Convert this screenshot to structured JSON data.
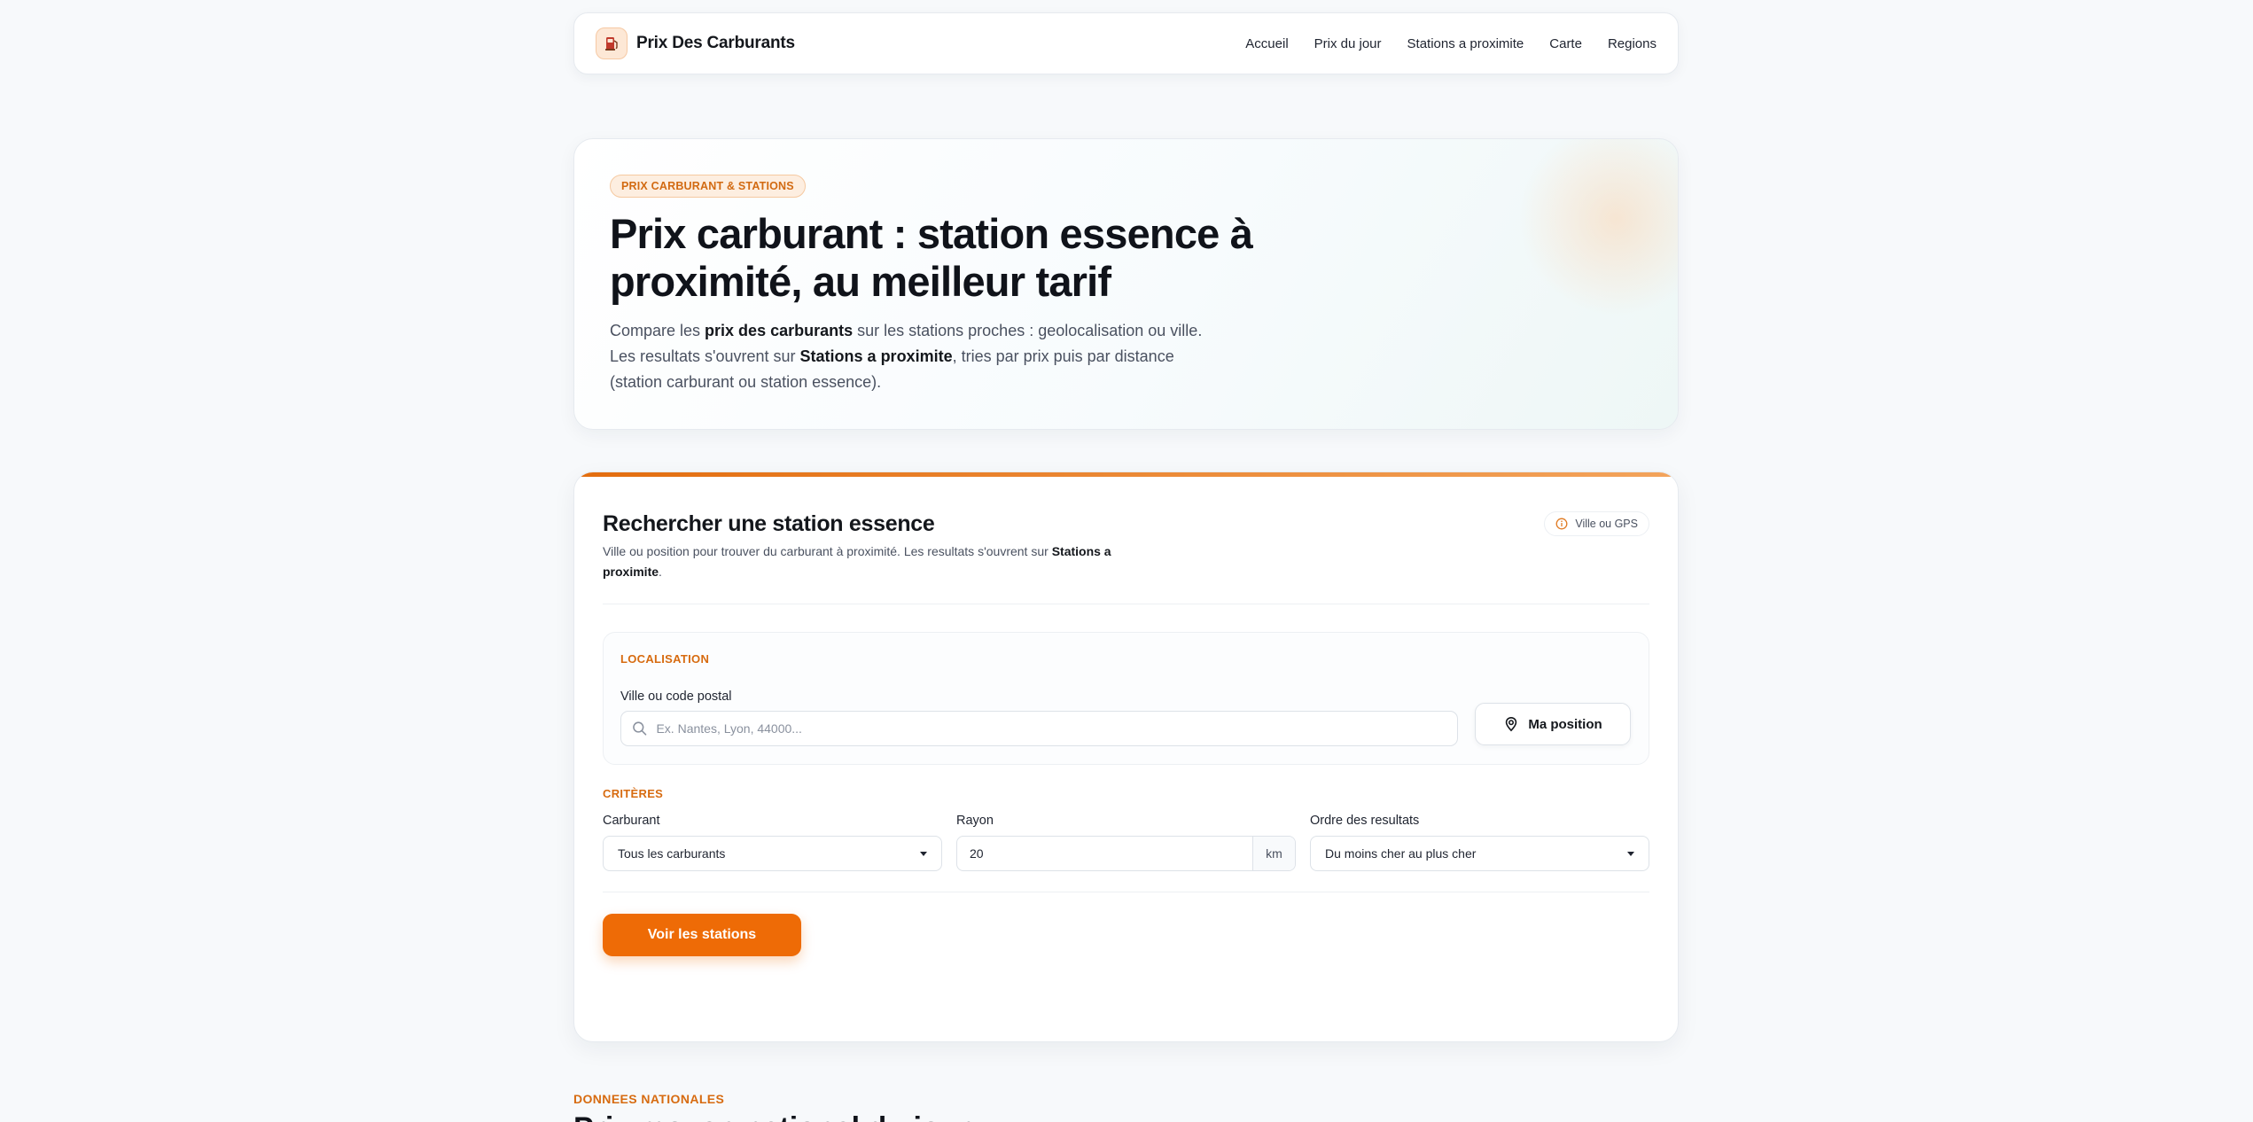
{
  "brand": {
    "name": "Prix Des Carburants",
    "logo_icon": "fuel-station-icon"
  },
  "nav": [
    "Accueil",
    "Prix du jour",
    "Stations a proximite",
    "Carte",
    "Regions"
  ],
  "hero": {
    "badge": "PRIX CARBURANT & STATIONS",
    "title": "Prix carburant : station essence à proximité, au meilleur tarif",
    "text_1": "Compare les ",
    "text_1_bold": "prix des carburants",
    "text_2": " sur les stations proches : geolocalisation ou ville. Les resultats s'ouvrent sur ",
    "text_2_bold": "Stations a proximite",
    "text_3": ", tries par prix puis par distance (station carburant ou station essence)."
  },
  "search": {
    "title": "Rechercher une station essence",
    "sub_1": "Ville ou position pour trouver du carburant à proximité. Les resultats s'ouvrent sur ",
    "sub_bold": "Stations a proximite",
    "sub_2": ".",
    "hint": "Ville ou GPS",
    "location_label": "LOCALISATION",
    "city_label": "Ville ou code postal",
    "city_placeholder": "Ex. Nantes, Lyon, 44000...",
    "city_value": "",
    "position_button": "Ma position",
    "criteria_label": "CRITÈRES",
    "fuel_label": "Carburant",
    "fuel_value": "Tous les carburants",
    "radius_label": "Rayon",
    "radius_value": "20",
    "radius_unit": "km",
    "order_label": "Ordre des resultats",
    "order_value": "Du moins cher au plus cher",
    "submit": "Voir les stations"
  },
  "national": {
    "label": "DONNEES NATIONALES",
    "title": "Prix moyen national du jour"
  },
  "colors": {
    "accent": "#ee6b06",
    "accent_text": "#d76b10"
  }
}
